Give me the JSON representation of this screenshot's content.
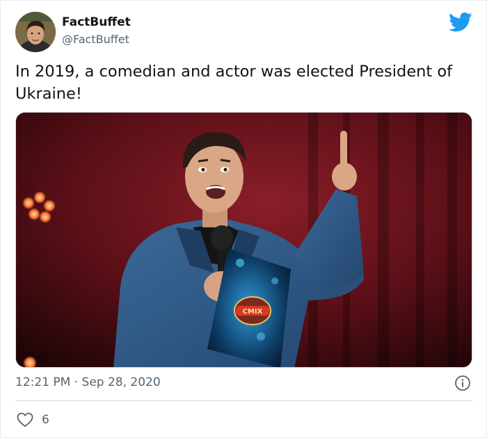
{
  "author": {
    "name": "FactBuffet",
    "handle": "@FactBuffet",
    "avatar_icon": "user-avatar"
  },
  "tweet": {
    "text": "In 2019, a comedian and actor was elected President of Ukraine!",
    "media_alt": "photo",
    "timestamp": "12:21 PM · Sep 28, 2020",
    "likes": "6"
  },
  "icons": {
    "brand": "twitter-bird-icon",
    "info": "info-icon",
    "like": "heart-icon"
  },
  "colors": {
    "twitter_blue": "#1d9bf0",
    "text_primary": "#0f1419",
    "text_secondary": "#536471",
    "border": "#cfd9de"
  }
}
